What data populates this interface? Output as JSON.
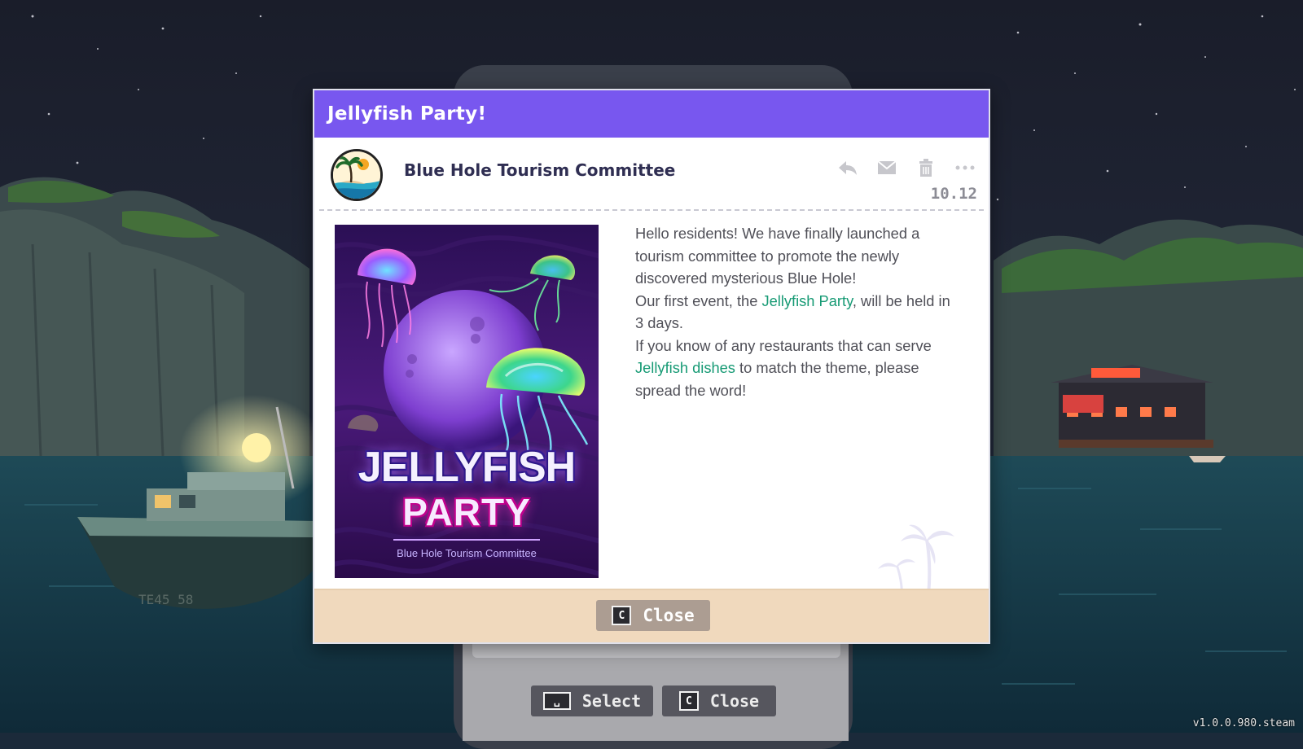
{
  "mail": {
    "title": "Jellyfish Party!",
    "sender": "Blue Hole Tourism Committee",
    "date": "10.12",
    "actions": [
      "reply-icon",
      "mail-icon",
      "trash-icon",
      "more-icon"
    ],
    "poster": {
      "title_line1": "JELLYFISH",
      "title_line2": "PARTY",
      "subtitle": "Blue Hole Tourism Committee"
    },
    "body": {
      "p1": "Hello residents! We have finally launched a tourism committee to promote the newly discovered mysterious Blue Hole!",
      "p2_before": "Our first event, the ",
      "p2_link": "Jellyfish Party",
      "p2_after": ", will be held in 3 days.",
      "p3_before": "If you know of any restaurants that can serve ",
      "p3_link": "Jellyfish dishes",
      "p3_after": " to match the theme, please spread the word!"
    },
    "close_button": {
      "key": "C",
      "label": "Close"
    }
  },
  "bottom_bar": {
    "select": {
      "key": "␣",
      "label": "Select"
    },
    "close": {
      "key": "C",
      "label": "Close"
    }
  },
  "version": "v1.0.0.980.steam",
  "colors": {
    "header": "#7857ef",
    "highlight": "#169a74",
    "footer": "#f0d9bd",
    "button": "#ac9d92"
  }
}
